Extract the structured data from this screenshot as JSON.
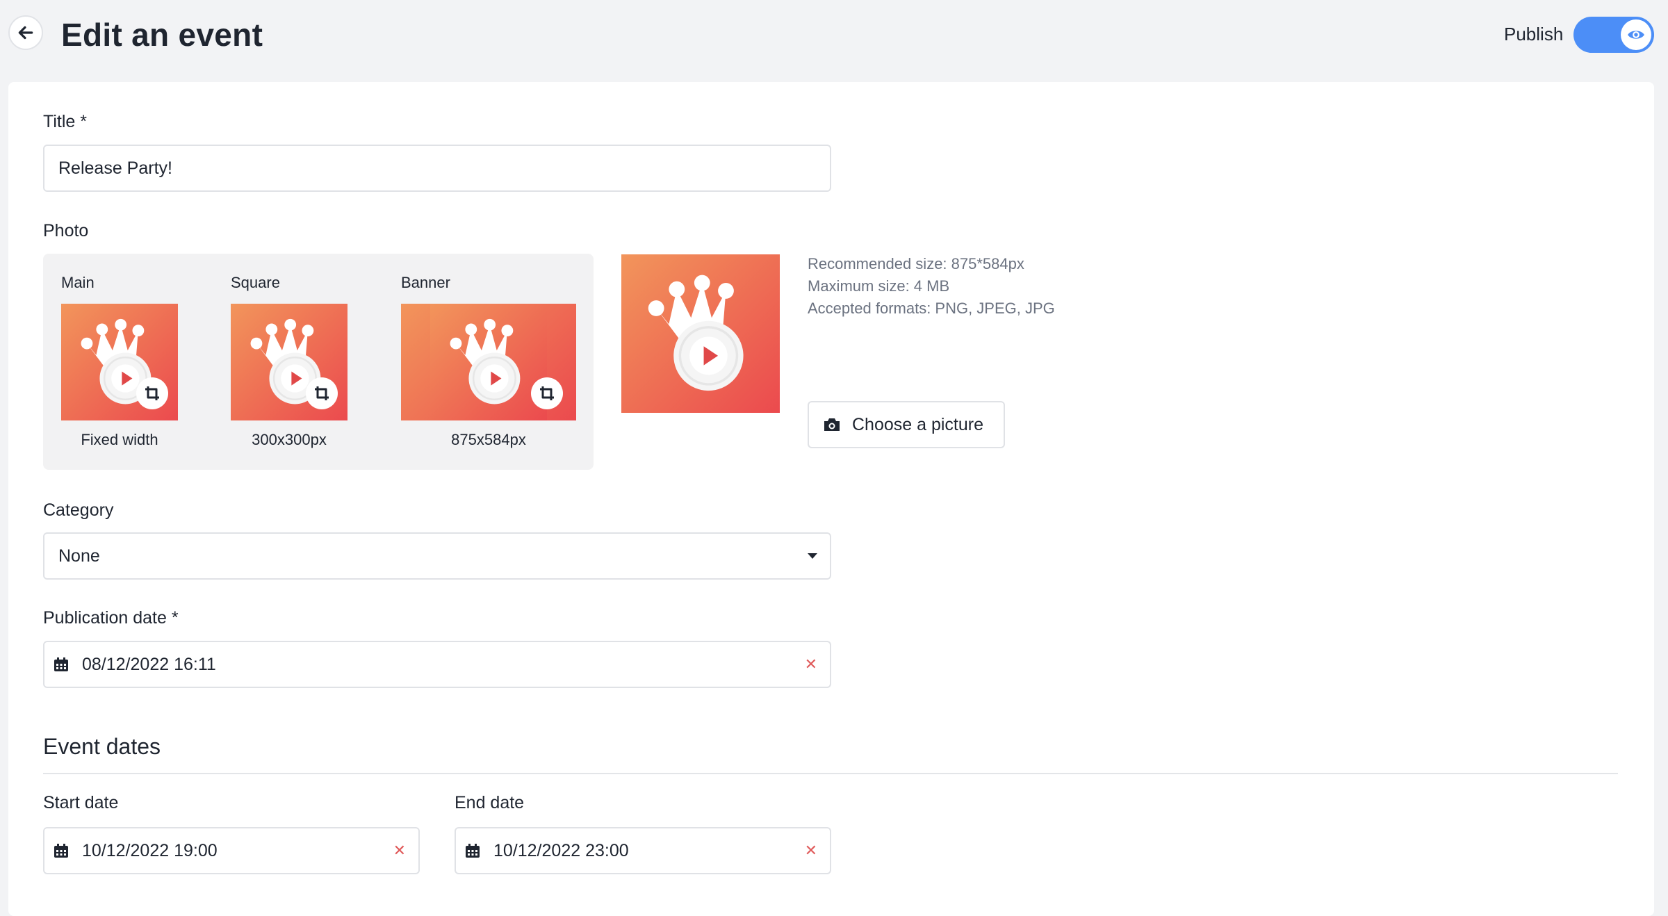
{
  "header": {
    "title": "Edit an event",
    "publish_label": "Publish",
    "publish_on": true
  },
  "form": {
    "title_label": "Title *",
    "title_value": "Release Party!",
    "photo_label": "Photo",
    "photo_variants": [
      {
        "label": "Main",
        "caption": "Fixed width"
      },
      {
        "label": "Square",
        "caption": "300x300px"
      },
      {
        "label": "Banner",
        "caption": "875x584px"
      }
    ],
    "photo_info": {
      "recommended": "Recommended size: 875*584px",
      "max_size": "Maximum size: 4 MB",
      "formats": "Accepted formats: PNG, JPEG, JPG"
    },
    "choose_button": "Choose a picture",
    "category_label": "Category",
    "category_value": "None",
    "publication_label": "Publication date *",
    "publication_value": "08/12/2022 16:11",
    "event_dates_title": "Event dates",
    "start_label": "Start date",
    "start_value": "10/12/2022 19:00",
    "end_label": "End date",
    "end_value": "10/12/2022 23:00"
  },
  "colors": {
    "accent": "#4c8ef7",
    "image_gradient_start": "#f08a5d",
    "image_gradient_end": "#ec4e4e",
    "clear_red": "#e05a5a"
  }
}
